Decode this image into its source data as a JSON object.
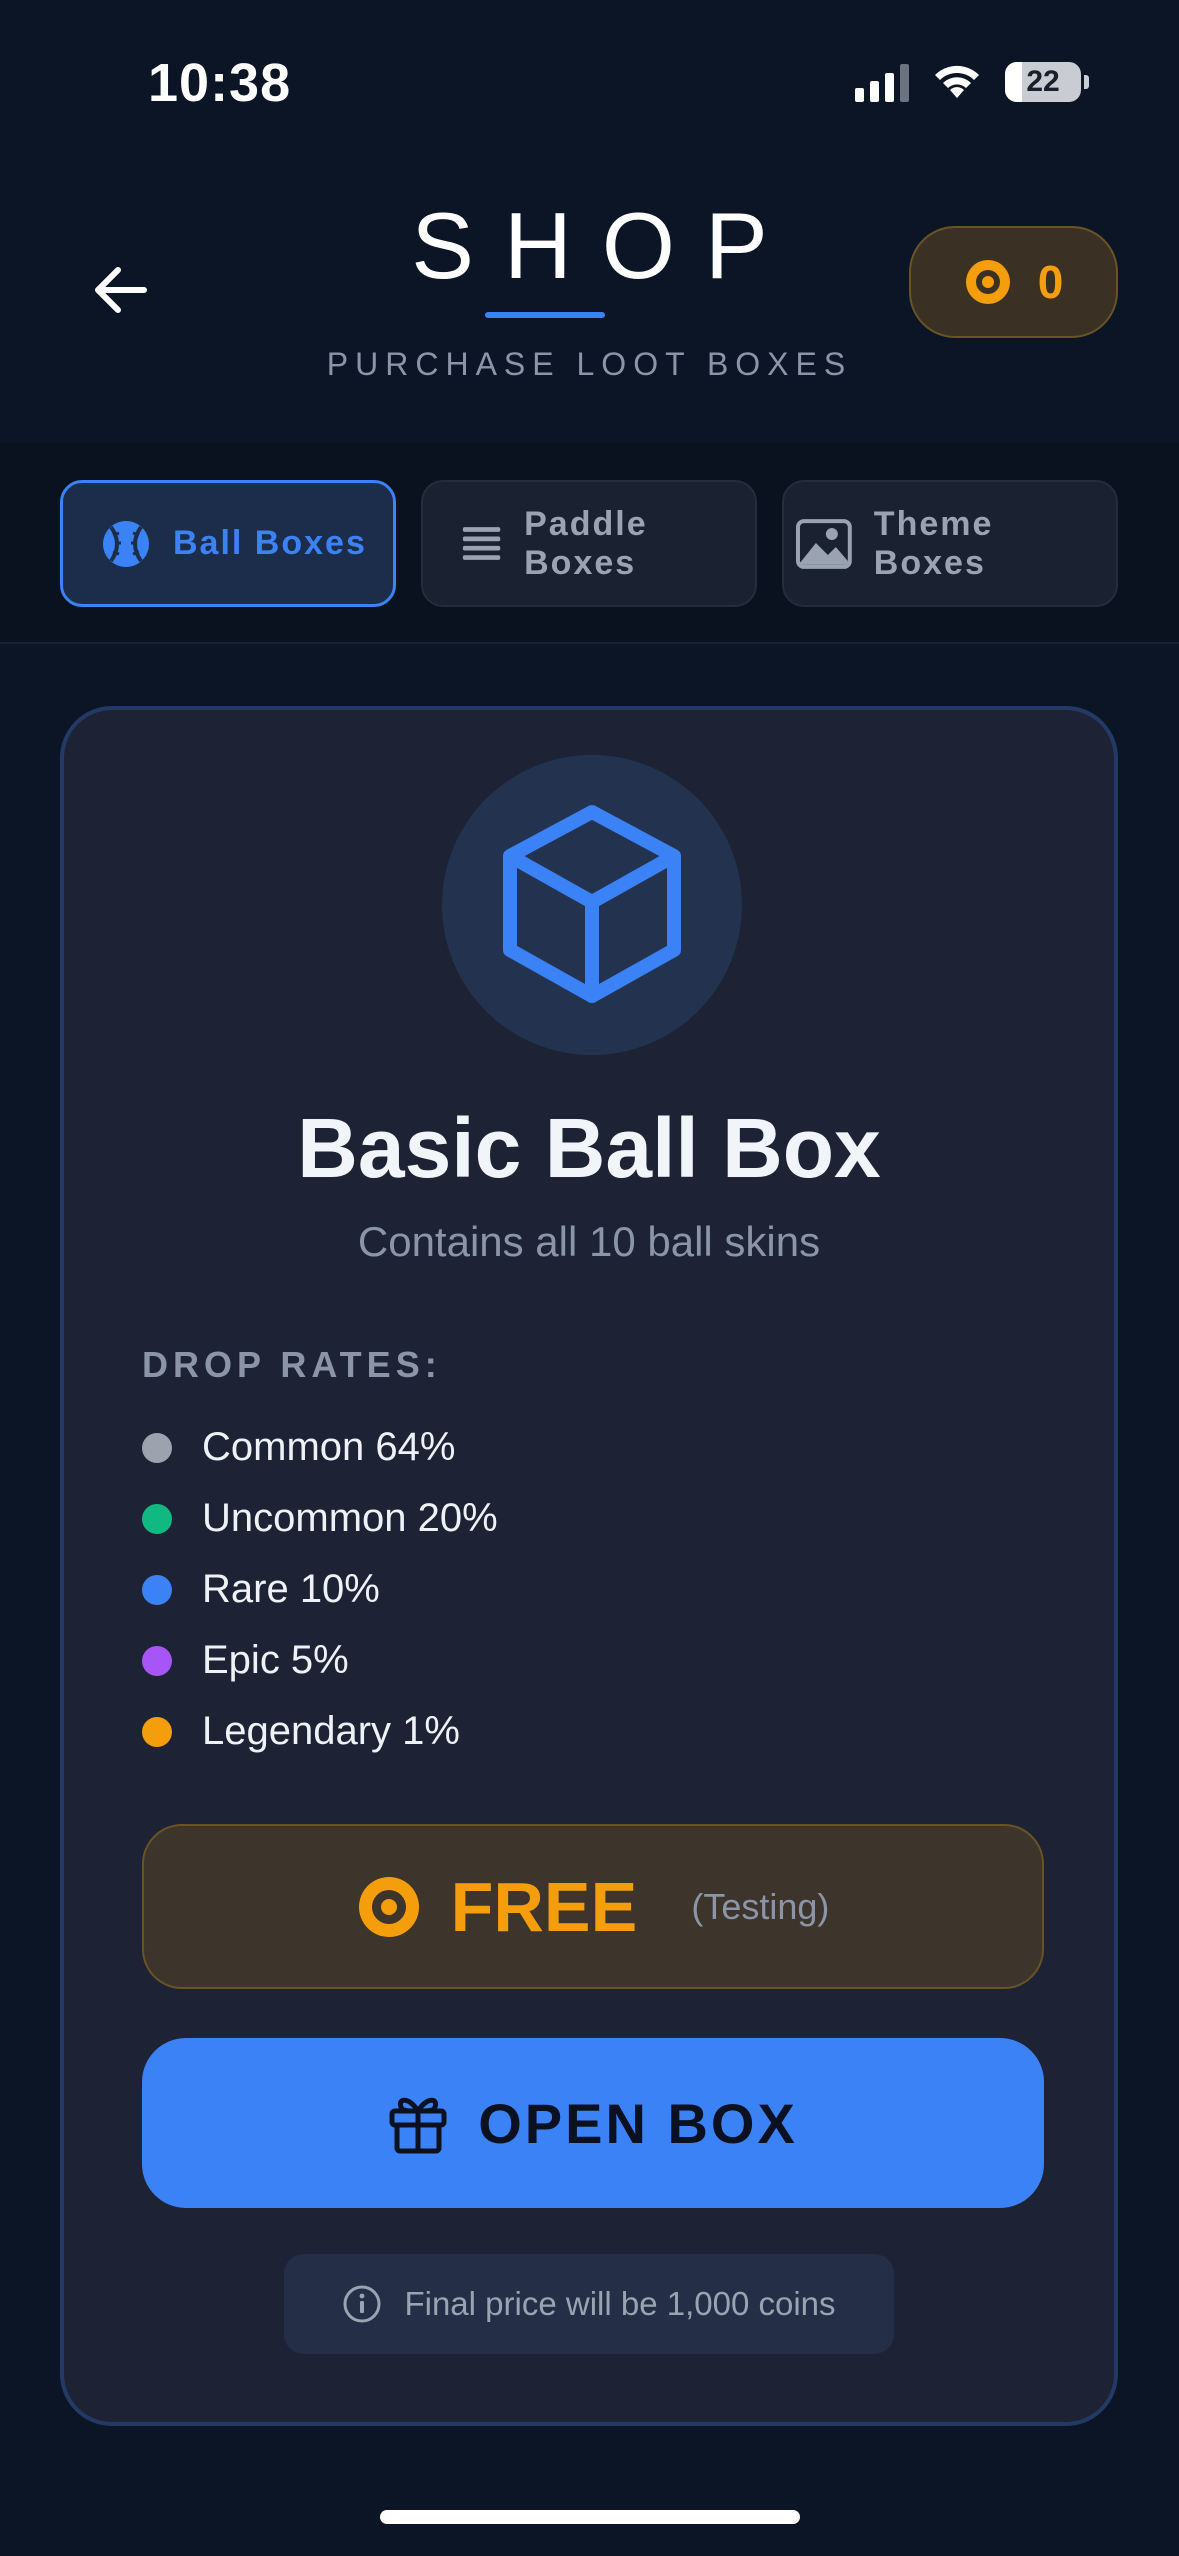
{
  "status_bar": {
    "time": "10:38",
    "battery": "22"
  },
  "header": {
    "title": "SHOP",
    "subtitle": "PURCHASE LOOT BOXES",
    "coins": "0"
  },
  "tabs": [
    {
      "label": "Ball Boxes",
      "icon": "baseball-icon",
      "active": true
    },
    {
      "label": "Paddle Boxes",
      "icon": "list-lines-icon",
      "active": false
    },
    {
      "label": "Theme Boxes",
      "icon": "image-icon",
      "active": false
    }
  ],
  "card": {
    "icon": "cube-icon",
    "name": "Basic Ball Box",
    "description": "Contains all 10 ball skins",
    "drop_rates_title": "DROP RATES:",
    "rates": [
      {
        "label": "Common 64%",
        "color": "#9ca3af"
      },
      {
        "label": "Uncommon 20%",
        "color": "#10b981"
      },
      {
        "label": "Rare 10%",
        "color": "#3b82f6"
      },
      {
        "label": "Epic 5%",
        "color": "#a855f7"
      },
      {
        "label": "Legendary 1%",
        "color": "#f59e0b"
      }
    ],
    "price": "FREE",
    "price_note": "(Testing)",
    "open_button": "OPEN BOX",
    "info": "Final price will be 1,000 coins"
  },
  "colors": {
    "accent": "#3b82f6",
    "coin": "#f59e0b",
    "background": "#0c1526",
    "card": "#1d2335"
  }
}
